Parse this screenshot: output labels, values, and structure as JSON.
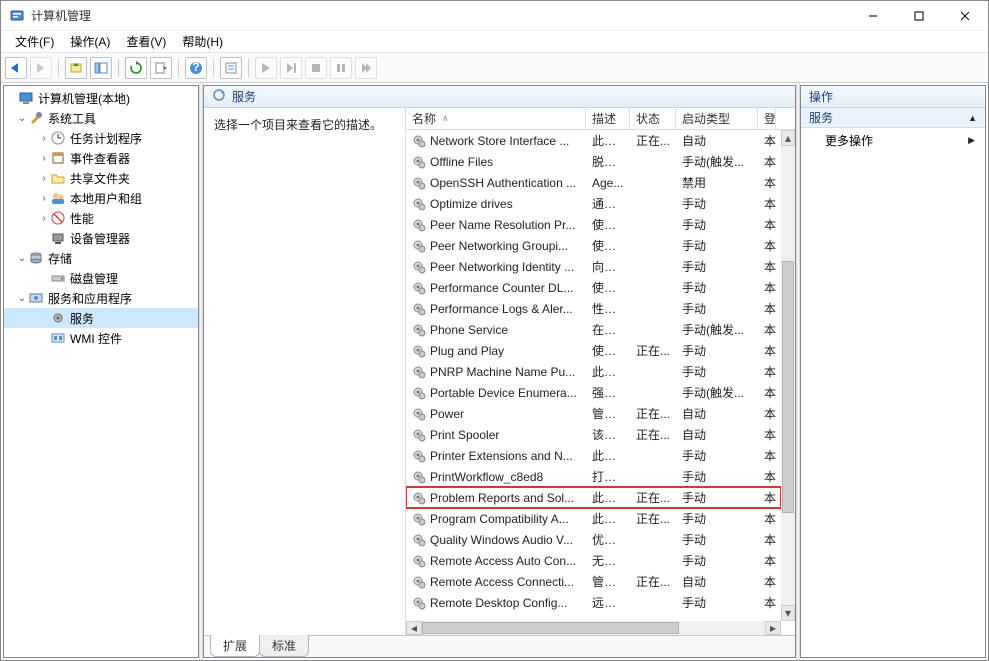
{
  "title": "计算机管理",
  "menus": [
    "文件(F)",
    "操作(A)",
    "查看(V)",
    "帮助(H)"
  ],
  "tree": {
    "root": "计算机管理(本地)",
    "system_tools": "系统工具",
    "task_scheduler": "任务计划程序",
    "event_viewer": "事件查看器",
    "shared_folders": "共享文件夹",
    "local_users": "本地用户和组",
    "performance": "性能",
    "device_manager": "设备管理器",
    "storage": "存储",
    "disk_mgmt": "磁盘管理",
    "services_apps": "服务和应用程序",
    "services": "服务",
    "wmi": "WMI 控件"
  },
  "center": {
    "header": "服务",
    "detail_hint": "选择一个项目来查看它的描述。",
    "columns": {
      "name": "名称",
      "desc": "描述",
      "status": "状态",
      "start": "启动类型",
      "logon": "登"
    },
    "tabs": {
      "extended": "扩展",
      "standard": "标准"
    }
  },
  "actions": {
    "header": "操作",
    "section": "服务",
    "more": "更多操作"
  },
  "services": [
    {
      "name": "Network Store Interface ...",
      "desc": "此服...",
      "status": "正在...",
      "start": "自动",
      "logon": "本"
    },
    {
      "name": "Offline Files",
      "desc": "脱机...",
      "status": "",
      "start": "手动(触发...",
      "logon": "本"
    },
    {
      "name": "OpenSSH Authentication ...",
      "desc": "Age...",
      "status": "",
      "start": "禁用",
      "logon": "本"
    },
    {
      "name": "Optimize drives",
      "desc": "通过...",
      "status": "",
      "start": "手动",
      "logon": "本"
    },
    {
      "name": "Peer Name Resolution Pr...",
      "desc": "使用...",
      "status": "",
      "start": "手动",
      "logon": "本"
    },
    {
      "name": "Peer Networking Groupi...",
      "desc": "使用...",
      "status": "",
      "start": "手动",
      "logon": "本"
    },
    {
      "name": "Peer Networking Identity ...",
      "desc": "向对...",
      "status": "",
      "start": "手动",
      "logon": "本"
    },
    {
      "name": "Performance Counter DL...",
      "desc": "使远...",
      "status": "",
      "start": "手动",
      "logon": "本"
    },
    {
      "name": "Performance Logs & Aler...",
      "desc": "性能...",
      "status": "",
      "start": "手动",
      "logon": "本"
    },
    {
      "name": "Phone Service",
      "desc": "在设...",
      "status": "",
      "start": "手动(触发...",
      "logon": "本"
    },
    {
      "name": "Plug and Play",
      "desc": "使计...",
      "status": "正在...",
      "start": "手动",
      "logon": "本"
    },
    {
      "name": "PNRP Machine Name Pu...",
      "desc": "此服...",
      "status": "",
      "start": "手动",
      "logon": "本"
    },
    {
      "name": "Portable Device Enumera...",
      "desc": "强制...",
      "status": "",
      "start": "手动(触发...",
      "logon": "本"
    },
    {
      "name": "Power",
      "desc": "管理...",
      "status": "正在...",
      "start": "自动",
      "logon": "本"
    },
    {
      "name": "Print Spooler",
      "desc": "该服...",
      "status": "正在...",
      "start": "自动",
      "logon": "本"
    },
    {
      "name": "Printer Extensions and N...",
      "desc": "此服...",
      "status": "",
      "start": "手动",
      "logon": "本"
    },
    {
      "name": "PrintWorkflow_c8ed8",
      "desc": "打印...",
      "status": "",
      "start": "手动",
      "logon": "本"
    },
    {
      "name": "Problem Reports and Sol...",
      "desc": "此服...",
      "status": "正在...",
      "start": "手动",
      "logon": "本",
      "highlight": true
    },
    {
      "name": "Program Compatibility A...",
      "desc": "此服...",
      "status": "正在...",
      "start": "手动",
      "logon": "本"
    },
    {
      "name": "Quality Windows Audio V...",
      "desc": "优质...",
      "status": "",
      "start": "手动",
      "logon": "本"
    },
    {
      "name": "Remote Access Auto Con...",
      "desc": "无论...",
      "status": "",
      "start": "手动",
      "logon": "本"
    },
    {
      "name": "Remote Access Connecti...",
      "desc": "管理...",
      "status": "正在...",
      "start": "自动",
      "logon": "本"
    },
    {
      "name": "Remote Desktop Config...",
      "desc": "远程...",
      "status": "",
      "start": "手动",
      "logon": "本"
    }
  ]
}
